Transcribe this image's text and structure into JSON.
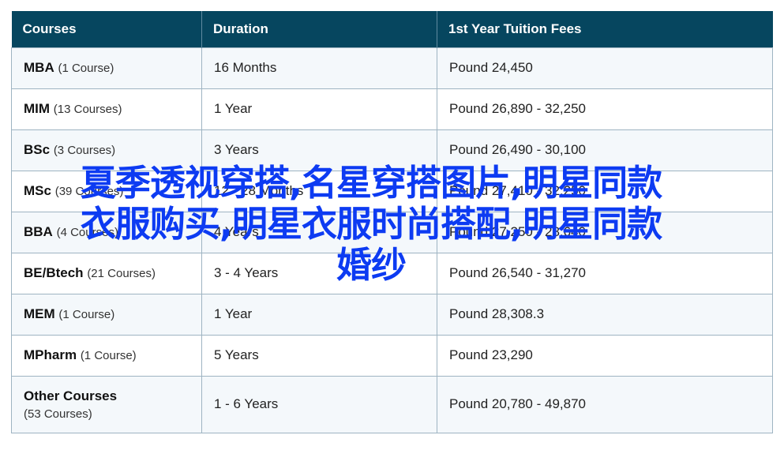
{
  "table": {
    "headers": [
      "Courses",
      "Duration",
      "1st Year Tuition Fees"
    ],
    "rows": [
      {
        "name": "MBA",
        "count": "(1 Course)",
        "duration": "16 Months",
        "fees": "Pound 24,450"
      },
      {
        "name": "MIM",
        "count": "(13 Courses)",
        "duration": "1 Year",
        "fees": "Pound 26,890 - 32,250"
      },
      {
        "name": "BSc",
        "count": "(3 Courses)",
        "duration": "3 Years",
        "fees": "Pound 26,490 - 30,100"
      },
      {
        "name": "MSc",
        "count": "(39 Courses)",
        "duration": "12 - 28 Months",
        "fees": "Pound 27,410 - 32,250"
      },
      {
        "name": "BBA",
        "count": "(4 Courses)",
        "duration": "4 Years",
        "fees": "Pound 27,250 - 28,640"
      },
      {
        "name": "BE/Btech",
        "count": "(21 Courses)",
        "duration": "3 - 4 Years",
        "fees": "Pound 26,540 - 31,270"
      },
      {
        "name": "MEM",
        "count": "(1 Course)",
        "duration": "1 Year",
        "fees": "Pound 28,308.3"
      },
      {
        "name": "MPharm",
        "count": "(1 Course)",
        "duration": "5 Years",
        "fees": "Pound 23,290"
      },
      {
        "name": "Other Courses",
        "count": "(53 Courses)",
        "duration": "1 - 6 Years",
        "fees": "Pound 20,780 - 49,870"
      }
    ]
  },
  "overlay": {
    "line1": "夏季透视穿搭,名星穿搭图片,明星同款",
    "line2": "衣服购买,明星衣服时尚搭配,明星同款",
    "line3": "婚纱"
  },
  "colors": {
    "header_bg": "#06465f",
    "row_alt_bg": "#f4f8fb",
    "border": "#9eb4c2",
    "overlay_text": "#0d3bf2"
  }
}
